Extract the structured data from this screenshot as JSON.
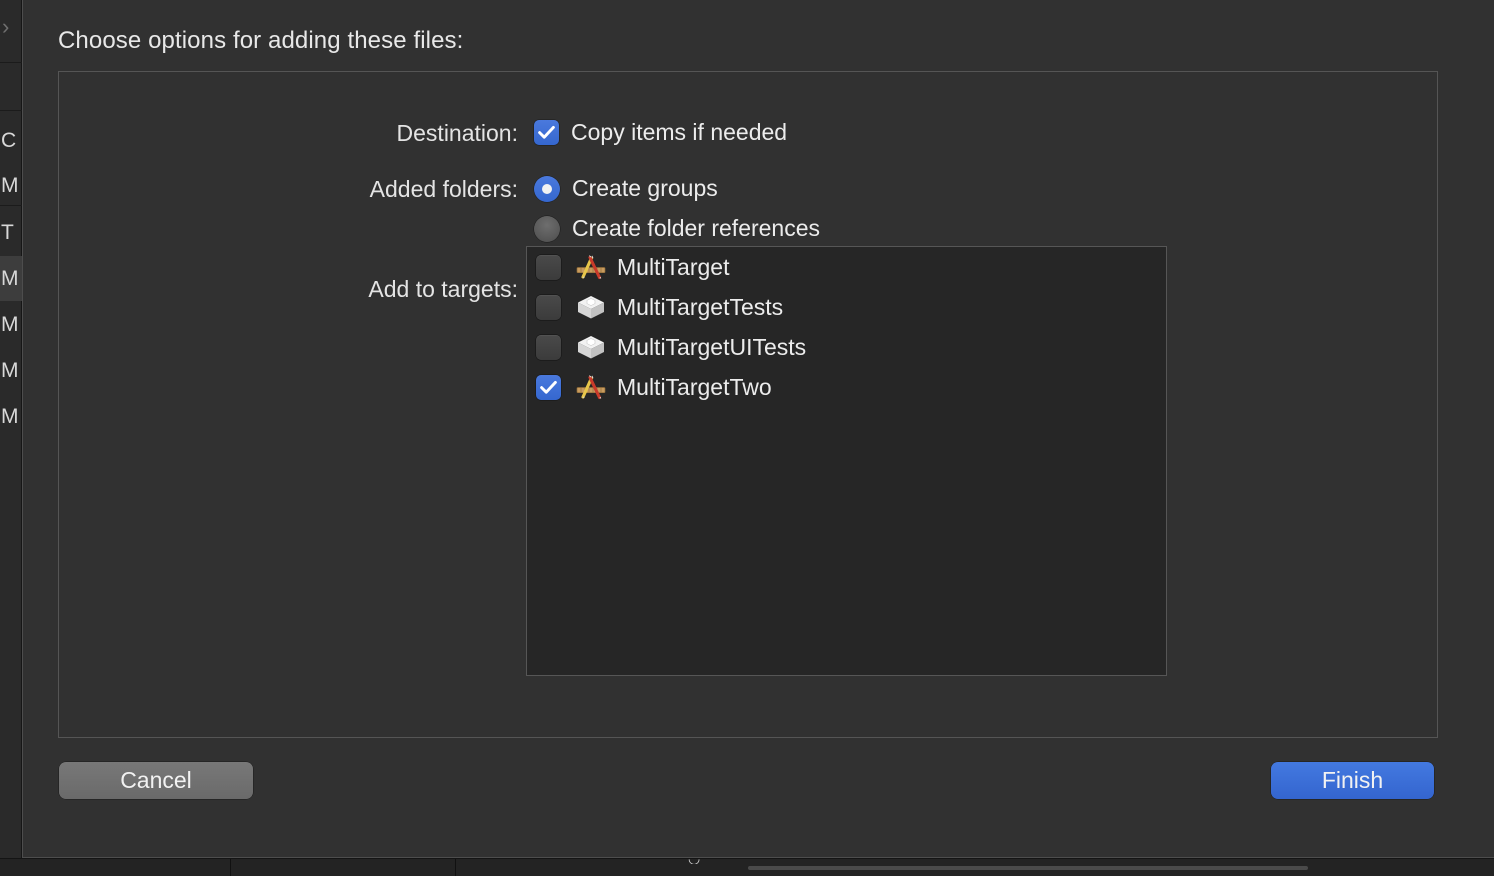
{
  "background": {
    "chevron_glyph": "›",
    "navigator_rows": [
      {
        "label": "C",
        "selected": false
      },
      {
        "label": "M",
        "selected": false
      },
      {
        "label": "T",
        "selected": false
      },
      {
        "label": "M",
        "selected": true
      },
      {
        "label": "M",
        "selected": false
      },
      {
        "label": "M",
        "selected": false
      },
      {
        "label": "M",
        "selected": false
      }
    ],
    "editor_fragment_text": "))",
    "status_glyph": "◡"
  },
  "sheet": {
    "title": "Choose options for adding these files:",
    "destination": {
      "label": "Destination:",
      "copy_items": {
        "label": "Copy items if needed",
        "checked": true
      }
    },
    "added_folders": {
      "label": "Added folders:",
      "options": [
        {
          "label": "Create groups",
          "selected": true
        },
        {
          "label": "Create folder references",
          "selected": false
        }
      ]
    },
    "add_to_targets": {
      "label": "Add to targets:",
      "rows": [
        {
          "name": "MultiTarget",
          "checked": false,
          "icon": "xcode-app-target-icon"
        },
        {
          "name": "MultiTargetTests",
          "checked": false,
          "icon": "test-bundle-icon"
        },
        {
          "name": "MultiTargetUITests",
          "checked": false,
          "icon": "test-bundle-icon"
        },
        {
          "name": "MultiTargetTwo",
          "checked": true,
          "icon": "xcode-app-target-icon"
        }
      ]
    },
    "buttons": {
      "cancel": "Cancel",
      "finish": "Finish"
    }
  },
  "colors": {
    "accent_blue": "#3a6fd8",
    "sheet_background": "#313131",
    "list_background": "#262626",
    "text_primary": "#ececec",
    "border": "#555555"
  }
}
